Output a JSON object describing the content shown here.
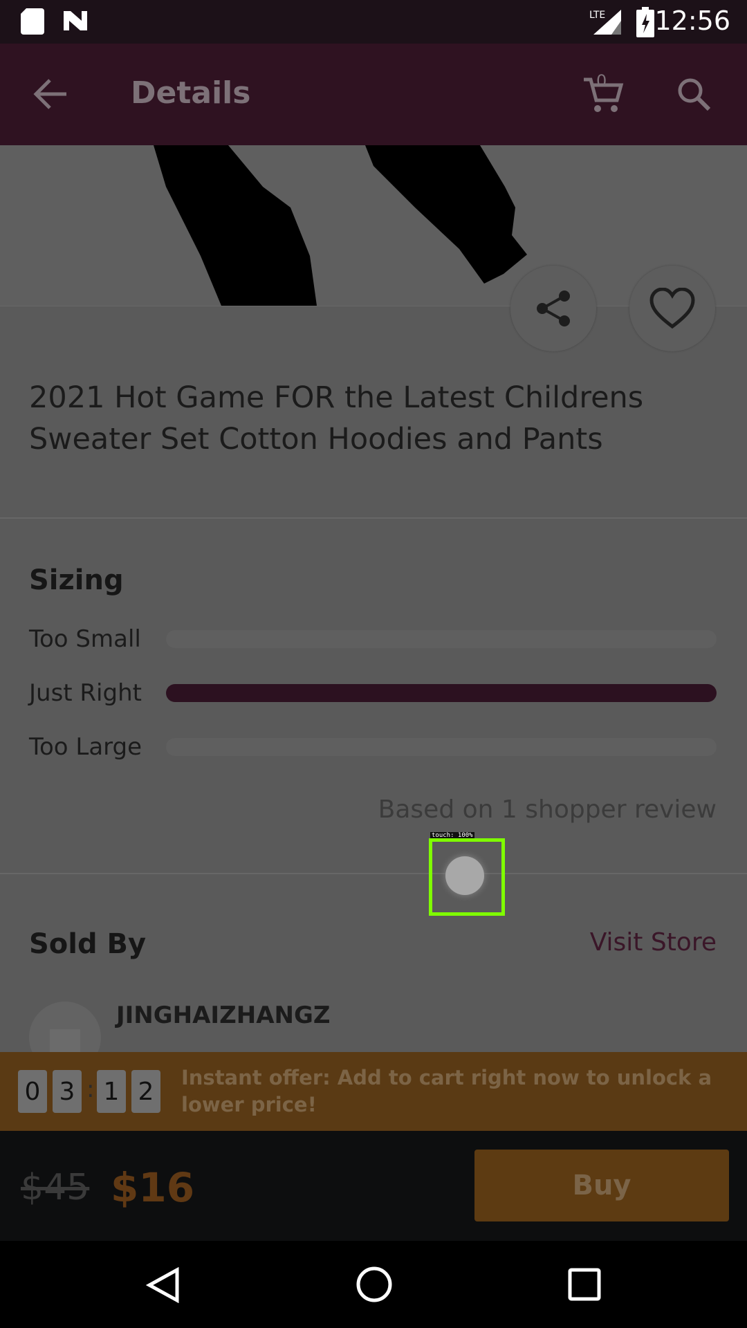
{
  "status_bar": {
    "time": "12:56",
    "network": "LTE"
  },
  "app_bar": {
    "title": "Details",
    "cart_count": "0"
  },
  "product": {
    "title": "2021 Hot Game FOR the Latest Childrens Sweater Set Cotton Hoodies and Pants"
  },
  "sizing": {
    "heading": "Sizing",
    "rows": [
      {
        "label": "Too Small",
        "fraction": 0
      },
      {
        "label": "Just Right",
        "fraction": 1
      },
      {
        "label": "Too Large",
        "fraction": 0
      }
    ],
    "review_note": "Based on 1 shopper review"
  },
  "seller": {
    "heading": "Sold By",
    "visit_label": "Visit Store",
    "name": "JINGHAIZHANGZ"
  },
  "offer": {
    "digits": [
      "0",
      "3",
      "1",
      "2"
    ],
    "separator": ":",
    "text": "Instant offer: Add to cart right now to unlock a lower price!"
  },
  "purchase": {
    "old_price": "$45",
    "new_price": "$16",
    "buy_label": "Buy"
  },
  "touch_overlay": {
    "label": "touch: 100%"
  },
  "colors": {
    "accent": "#2c1120",
    "offer_bg": "#5a3a14",
    "buy_bg": "#5d3b12"
  }
}
